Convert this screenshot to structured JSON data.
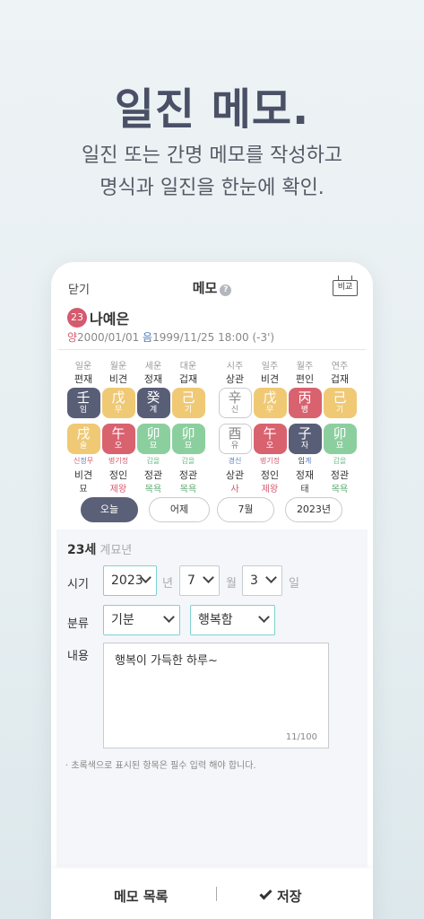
{
  "hero": {
    "title": "일진 메모.",
    "subtitle_line1": "일진 또는 간명 메모를 작성하고",
    "subtitle_line2": "명식과 일진을 한눈에 확인."
  },
  "topbar": {
    "close_label": "닫기",
    "title": "메모",
    "help_icon": "?",
    "compare_label": "비교"
  },
  "profile": {
    "age_badge": "23",
    "name": "나예은",
    "yang_prefix": "양",
    "solar_date": "2000/01/01",
    "eum_prefix": "음",
    "lunar_datetime": "1999/11/25 18:00 (-3')"
  },
  "columns": [
    {
      "label": "일운",
      "top_ten": "편재",
      "top_hanja": "壬",
      "top_kor": "임",
      "top_color": "#595e77",
      "top_outline": false,
      "bot_hanja": "戌",
      "bot_kor": "술",
      "bot_color": "#efc974",
      "bot_outline": false,
      "sub": [
        {
          "t": "신",
          "c": "r"
        },
        {
          "t": "정",
          "c": "b"
        },
        {
          "t": "무",
          "c": "r"
        }
      ],
      "bot_ten": "비견",
      "stage": "묘",
      "stage_color": "dark"
    },
    {
      "label": "월운",
      "top_ten": "비견",
      "top_hanja": "戊",
      "top_kor": "무",
      "top_color": "#efc974",
      "top_outline": false,
      "bot_hanja": "午",
      "bot_kor": "오",
      "bot_color": "#d9626f",
      "bot_outline": false,
      "sub": [
        {
          "t": "병",
          "c": "r"
        },
        {
          "t": "기",
          "c": "r"
        },
        {
          "t": "정",
          "c": "r"
        }
      ],
      "bot_ten": "정인",
      "stage": "제왕",
      "stage_color": "red"
    },
    {
      "label": "세운",
      "top_ten": "정재",
      "top_hanja": "癸",
      "top_kor": "계",
      "top_color": "#595e77",
      "top_outline": false,
      "bot_hanja": "卯",
      "bot_kor": "묘",
      "bot_color": "#8ccf9f",
      "bot_outline": false,
      "sub": [
        {
          "t": "갑",
          "c": "g"
        },
        {
          "t": "을",
          "c": "g"
        }
      ],
      "bot_ten": "정관",
      "stage": "목욕",
      "stage_color": "green"
    },
    {
      "label": "대운",
      "top_ten": "겁재",
      "top_hanja": "己",
      "top_kor": "기",
      "top_color": "#efc974",
      "top_outline": false,
      "bot_hanja": "卯",
      "bot_kor": "묘",
      "bot_color": "#8ccf9f",
      "bot_outline": false,
      "sub": [
        {
          "t": "갑",
          "c": "g"
        },
        {
          "t": "을",
          "c": "g"
        }
      ],
      "bot_ten": "정관",
      "stage": "목욕",
      "stage_color": "green"
    },
    {
      "label": "시주",
      "top_ten": "상관",
      "top_hanja": "辛",
      "top_kor": "신",
      "top_color": "#ffffff",
      "top_outline": true,
      "bot_hanja": "酉",
      "bot_kor": "유",
      "bot_color": "#ffffff",
      "bot_outline": true,
      "sub": [
        {
          "t": "경",
          "c": "b"
        },
        {
          "t": "신",
          "c": "b"
        }
      ],
      "bot_ten": "상관",
      "stage": "사",
      "stage_color": "red"
    },
    {
      "label": "일주",
      "top_ten": "비견",
      "top_hanja": "戊",
      "top_kor": "무",
      "top_color": "#efc974",
      "top_outline": false,
      "bot_hanja": "午",
      "bot_kor": "오",
      "bot_color": "#d9626f",
      "bot_outline": false,
      "sub": [
        {
          "t": "병",
          "c": "r"
        },
        {
          "t": "기",
          "c": "r"
        },
        {
          "t": "정",
          "c": "r"
        }
      ],
      "bot_ten": "정인",
      "stage": "제왕",
      "stage_color": "red"
    },
    {
      "label": "월주",
      "top_ten": "편인",
      "top_hanja": "丙",
      "top_kor": "병",
      "top_color": "#d9626f",
      "top_outline": false,
      "bot_hanja": "子",
      "bot_kor": "자",
      "bot_color": "#595e77",
      "bot_outline": false,
      "sub": [
        {
          "t": "임",
          "c": "n"
        },
        {
          "t": "계",
          "c": "b"
        }
      ],
      "bot_ten": "정재",
      "stage": "태",
      "stage_color": "dark"
    },
    {
      "label": "연주",
      "top_ten": "겁재",
      "top_hanja": "己",
      "top_kor": "기",
      "top_color": "#efc974",
      "top_outline": false,
      "bot_hanja": "卯",
      "bot_kor": "묘",
      "bot_color": "#8ccf9f",
      "bot_outline": false,
      "sub": [
        {
          "t": "갑",
          "c": "g"
        },
        {
          "t": "을",
          "c": "g"
        }
      ],
      "bot_ten": "정관",
      "stage": "목욕",
      "stage_color": "green"
    }
  ],
  "pills": [
    {
      "label": "오늘",
      "active": true
    },
    {
      "label": "어제",
      "active": false
    },
    {
      "label": "7월",
      "active": false
    },
    {
      "label": "2023년",
      "active": false
    }
  ],
  "form": {
    "age": "23세",
    "year_name": "계묘년",
    "period_label": "시기",
    "year_value": "2023",
    "year_unit": "년",
    "month_value": "7",
    "month_unit": "월",
    "day_value": "3",
    "day_unit": "일",
    "category_label": "분류",
    "category_value": "기분",
    "subcategory_value": "행복함",
    "content_label": "내용",
    "content_value": "행복이 가득한 하루~",
    "counter": "11/100",
    "hint": "· 초록색으로 표시된 항목은 필수 입력 해야 합니다."
  },
  "bottom": {
    "list_label": "메모 목록",
    "save_label": "저장"
  }
}
